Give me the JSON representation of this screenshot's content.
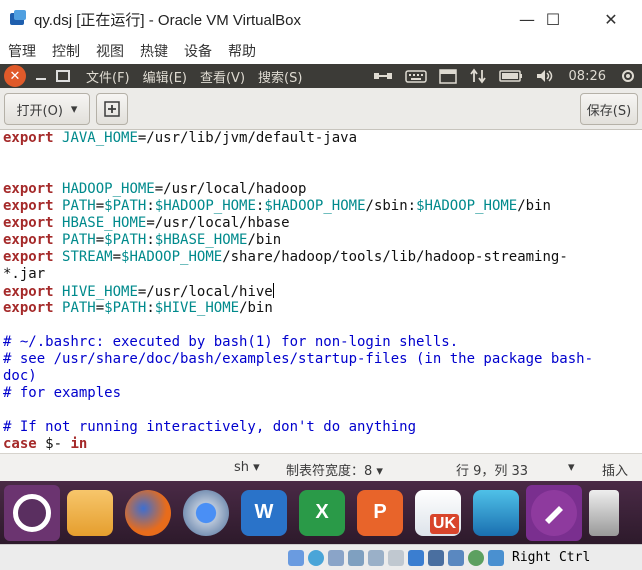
{
  "window": {
    "title": "qy.dsj [正在运行] - Oracle VM VirtualBox",
    "min_glyph": "—",
    "max_glyph": "☐",
    "close_glyph": "✕"
  },
  "host_menu": [
    "管理",
    "控制",
    "视图",
    "热键",
    "设备",
    "帮助"
  ],
  "guest_panel": {
    "close_glyph": "✕",
    "menus": [
      "文件(F)",
      "编辑(E)",
      "查看(V)",
      "搜索(S)"
    ],
    "clock": "08:26"
  },
  "toolbar": {
    "open_label": "打开(O)",
    "open_arrow": "▾",
    "save_label": "保存(S)"
  },
  "editor": {
    "lines": [
      [
        [
          "kw",
          "export"
        ],
        [
          "t",
          " "
        ],
        [
          "var",
          "JAVA_HOME"
        ],
        [
          "t",
          "=/usr/lib/jvm/default-java"
        ]
      ],
      [],
      [],
      [
        [
          "kw",
          "export"
        ],
        [
          "t",
          " "
        ],
        [
          "var",
          "HADOOP_HOME"
        ],
        [
          "t",
          "=/usr/local/hadoop"
        ]
      ],
      [
        [
          "kw",
          "export"
        ],
        [
          "t",
          " "
        ],
        [
          "var",
          "PATH"
        ],
        [
          "t",
          "="
        ],
        [
          "var",
          "$PATH"
        ],
        [
          "t",
          ":"
        ],
        [
          "var",
          "$HADOOP_HOME"
        ],
        [
          "t",
          ":"
        ],
        [
          "var",
          "$HADOOP_HOME"
        ],
        [
          "t",
          "/sbin:"
        ],
        [
          "var",
          "$HADOOP_HOME"
        ],
        [
          "t",
          "/bin"
        ]
      ],
      [
        [
          "kw",
          "export"
        ],
        [
          "t",
          " "
        ],
        [
          "var",
          "HBASE_HOME"
        ],
        [
          "t",
          "=/usr/local/hbase"
        ]
      ],
      [
        [
          "kw",
          "export"
        ],
        [
          "t",
          " "
        ],
        [
          "var",
          "PATH"
        ],
        [
          "t",
          "="
        ],
        [
          "var",
          "$PATH"
        ],
        [
          "t",
          ":"
        ],
        [
          "var",
          "$HBASE_HOME"
        ],
        [
          "t",
          "/bin"
        ]
      ],
      [
        [
          "kw",
          "export"
        ],
        [
          "t",
          " "
        ],
        [
          "var",
          "STREAM"
        ],
        [
          "t",
          "="
        ],
        [
          "var",
          "$HADOOP_HOME"
        ],
        [
          "t",
          "/share/hadoop/tools/lib/hadoop-streaming-"
        ]
      ],
      [
        [
          "t",
          "*.jar"
        ]
      ],
      [
        [
          "kw",
          "export"
        ],
        [
          "t",
          " "
        ],
        [
          "var",
          "HIVE_HOME"
        ],
        [
          "t",
          "=/usr/local/hive"
        ],
        [
          "caret",
          ""
        ]
      ],
      [
        [
          "kw",
          "export"
        ],
        [
          "t",
          " "
        ],
        [
          "var",
          "PATH"
        ],
        [
          "t",
          "="
        ],
        [
          "var",
          "$PATH"
        ],
        [
          "t",
          ":"
        ],
        [
          "var",
          "$HIVE_HOME"
        ],
        [
          "t",
          "/bin"
        ]
      ],
      [],
      [
        [
          "cm",
          "# ~/.bashrc: executed by bash(1) for non-login shells."
        ]
      ],
      [
        [
          "cm",
          "# see /usr/share/doc/bash/examples/startup-files (in the package bash-"
        ]
      ],
      [
        [
          "cm",
          "doc)"
        ]
      ],
      [
        [
          "cm",
          "# for examples"
        ]
      ],
      [],
      [
        [
          "cm",
          "# If not running interactively, don't do anything"
        ]
      ],
      [
        [
          "kw",
          "case"
        ],
        [
          "t",
          " $- "
        ],
        [
          "kw",
          "in"
        ]
      ]
    ]
  },
  "statusbar": {
    "language": "sh ▾",
    "tab_width": "制表符宽度：8 ▾",
    "position": "行 9，列 33",
    "arrow": "▾",
    "mode": "插入"
  },
  "dock": {
    "word_letter": "W",
    "excel_letter": "X",
    "ppt_letter": "P",
    "uk_label": "UK"
  },
  "hoststrip": {
    "hotkey": "Right Ctrl"
  }
}
